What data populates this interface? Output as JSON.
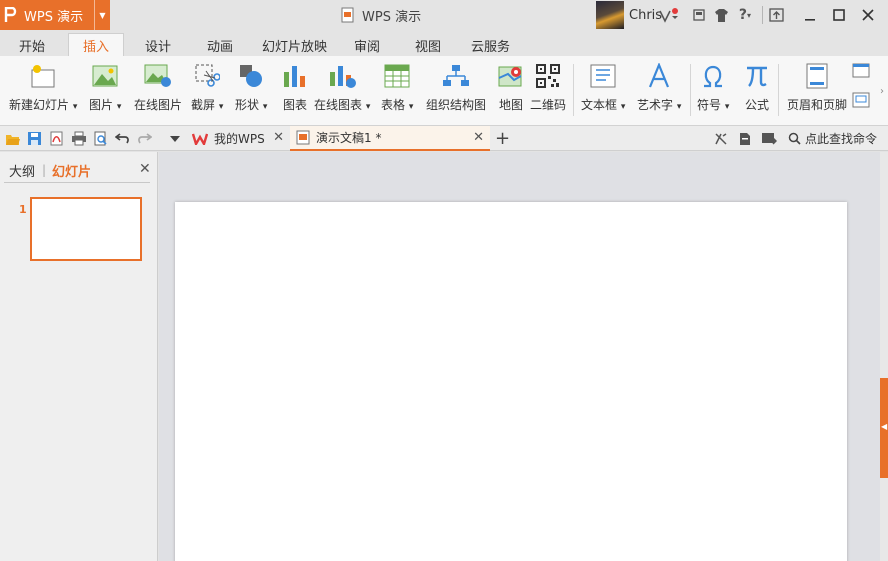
{
  "app": {
    "menu_button": "WPS 演示",
    "window_title": "WPS 演示",
    "user_name": "Chris"
  },
  "title_icons": [
    "skin-icon",
    "tshirt-icon",
    "help-icon",
    "share-icon",
    "minimize-icon",
    "maximize-icon",
    "close-icon"
  ],
  "help_label": "?",
  "menu_tabs": [
    {
      "label": "开始"
    },
    {
      "label": "插入"
    },
    {
      "label": "设计"
    },
    {
      "label": "动画"
    },
    {
      "label": "幻灯片放映"
    },
    {
      "label": "审阅"
    },
    {
      "label": "视图"
    },
    {
      "label": "云服务"
    }
  ],
  "active_tab": "插入",
  "ribbon": {
    "new_slide": "新建幻灯片",
    "picture": "图片",
    "online_picture": "在线图片",
    "screenshot": "截屏",
    "shape": "形状",
    "chart": "图表",
    "online_chart": "在线图表",
    "table": "表格",
    "org_chart": "组织结构图",
    "map": "地图",
    "qrcode": "二维码",
    "textbox": "文本框",
    "art_text": "艺术字",
    "symbol": "符号",
    "equation": "公式",
    "header_footer": "页眉和页脚",
    "dropdown_arrow": "▾"
  },
  "tabs_bar": {
    "my_wps": "我的WPS",
    "document": "演示文稿1 *",
    "find_command": "点此查找命令"
  },
  "left_pane": {
    "outline_tab": "大纲",
    "slides_tab": "幻灯片",
    "divider": "|",
    "slide_number": "1"
  },
  "colors": {
    "accent": "#e8702a",
    "title_bg": "#e4e4e4",
    "ribbon_bg": "#f7f7f7",
    "editor_bg": "#dfe0e4"
  }
}
